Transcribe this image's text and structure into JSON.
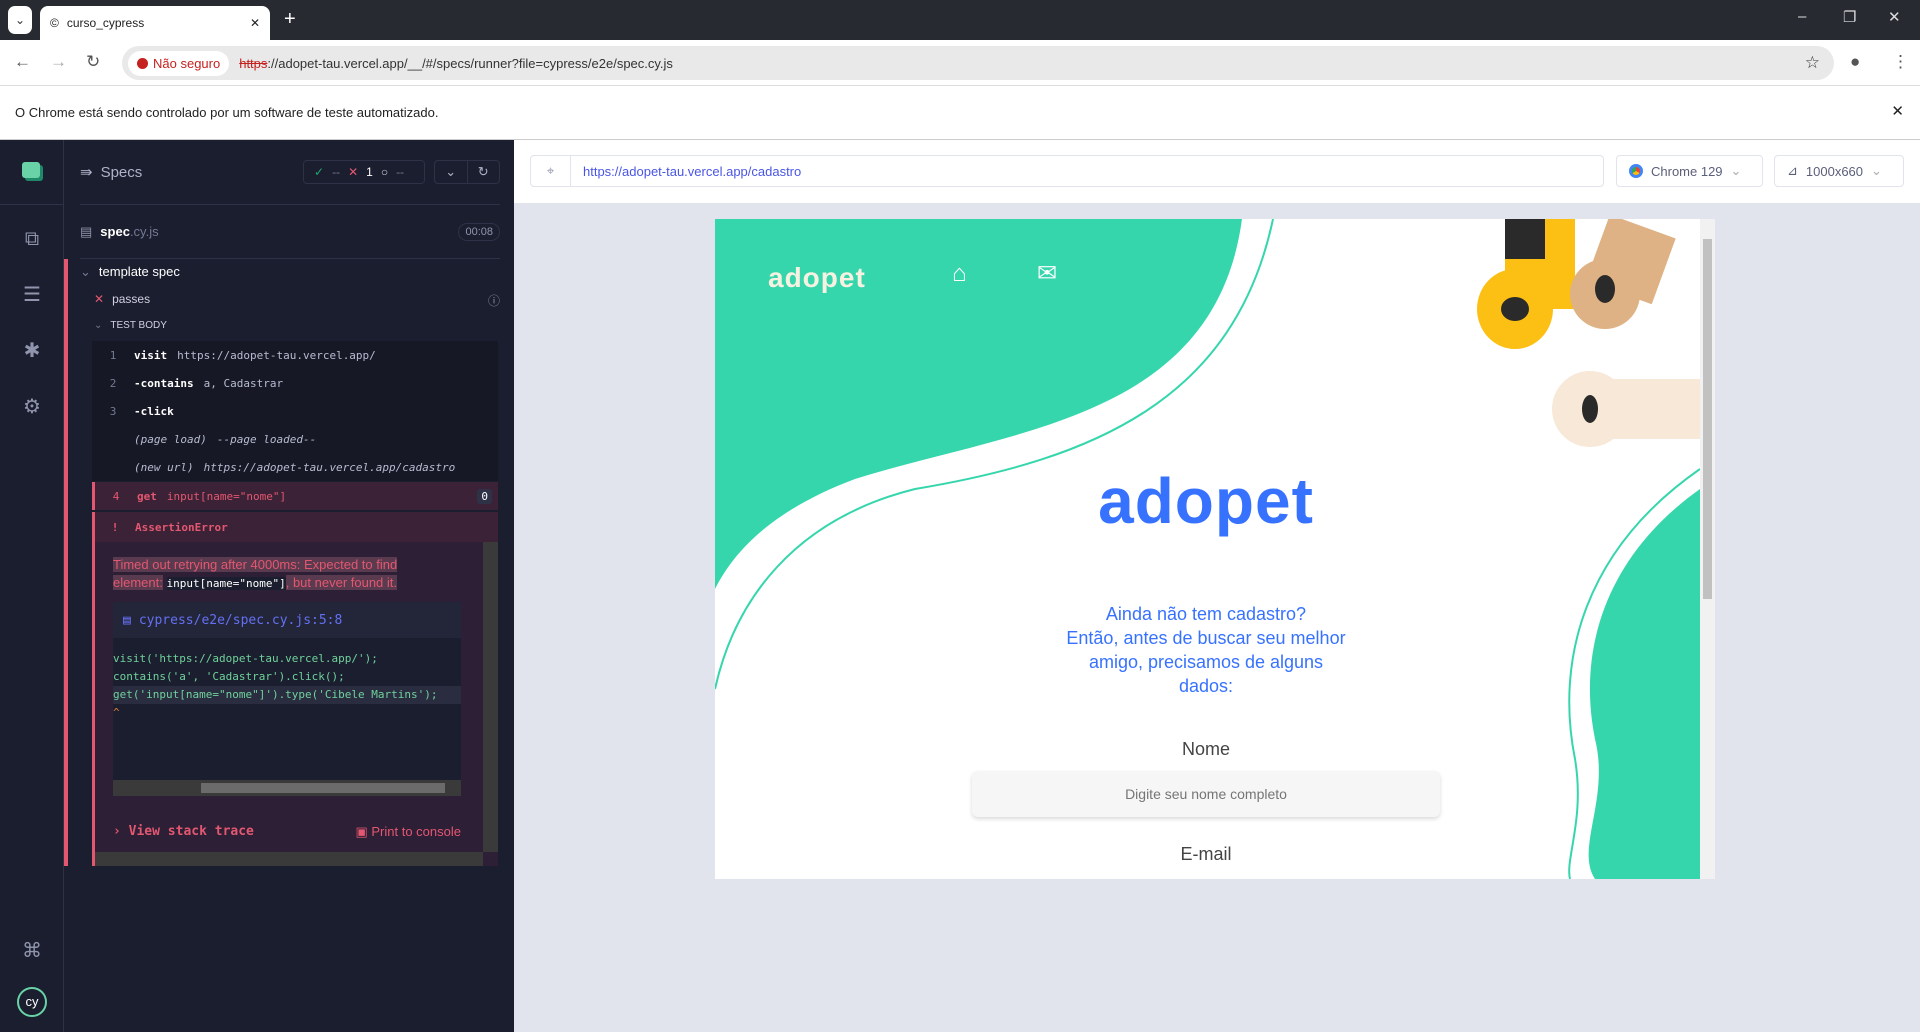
{
  "browser": {
    "tab_title": "curso_cypress",
    "security_label": "Não seguro",
    "url_scheme": "https",
    "url_rest": "://adopet-tau.vercel.app/__/#/specs/runner?file=cypress/e2e/spec.cy.js",
    "automation_notice": "O Chrome está sendo controlado por um software de teste automatizado."
  },
  "reporter": {
    "title": "Specs",
    "passed": "--",
    "failed": "1",
    "pending": "--",
    "spec_name": "spec",
    "spec_ext": ".cy.js",
    "duration": "00:08",
    "suite": "template spec",
    "test": "passes",
    "test_body": "TEST BODY",
    "commands": [
      {
        "num": "1",
        "name": "visit",
        "msg": "https://adopet-tau.vercel.app/"
      },
      {
        "num": "2",
        "name": "-contains",
        "msg": "a, Cadastrar"
      },
      {
        "num": "3",
        "name": "-click",
        "msg": ""
      },
      {
        "num": "",
        "name": "(page load)",
        "msg": "--page loaded--"
      },
      {
        "num": "",
        "name": "(new url)",
        "msg": "https://adopet-tau.vercel.app/cadastro"
      },
      {
        "num": "4",
        "name": "get",
        "msg": "input[name=\"nome\"]",
        "badge": "0"
      }
    ],
    "error": {
      "mark": "!",
      "name": "AssertionError",
      "msg1": "Timed out retrying after 4000ms: Expected to find element:",
      "selector": "input[name=\"nome\"]",
      "msg2": ", but never found it.",
      "file": "cypress/e2e/spec.cy.js:5:8",
      "code": [
        "visit('https://adopet-tau.vercel.app/');",
        "contains('a', 'Cadastrar').click();",
        "get('input[name=\"nome\"]').type('Cibele Martins');",
        "^"
      ],
      "stack_label": "View stack trace",
      "print_label": "Print to console"
    }
  },
  "aut": {
    "url": "https://adopet-tau.vercel.app/cadastro",
    "browser": "Chrome 129",
    "viewport": "1000x660"
  },
  "page": {
    "logo": "adopet",
    "big_logo": "adopet",
    "intro": [
      "Ainda não tem cadastro?",
      "Então, antes de buscar seu melhor",
      "amigo, precisamos de alguns",
      "dados:"
    ],
    "name_label": "Nome",
    "name_placeholder": "Digite seu nome completo",
    "email_label": "E-mail"
  },
  "colors": {
    "accent_green": "#36d6ad",
    "adopet_blue": "#3772ff",
    "error_red": "#e45770"
  }
}
